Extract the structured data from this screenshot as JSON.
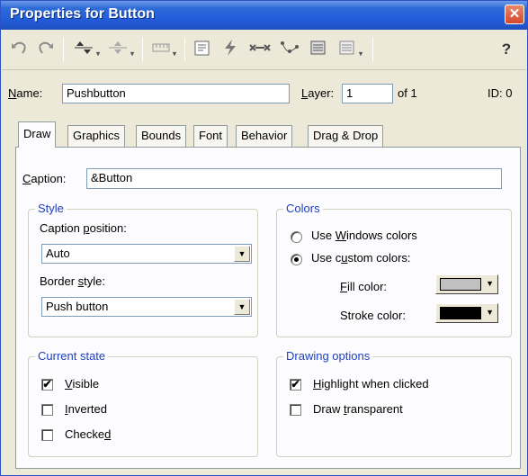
{
  "window": {
    "title": "Properties for Button",
    "close_glyph": "✕"
  },
  "toolbar": {
    "icons": [
      "undo-icon",
      "redo-icon",
      "align-icon",
      "distribute-icon",
      "ruler-icon",
      "properties-icon",
      "lightning-icon",
      "connector-icon",
      "path-icon",
      "list-icon",
      "list-dropdown-icon",
      "help-icon"
    ],
    "help_glyph": "?"
  },
  "object": {
    "name_label_u": "N",
    "name_label_rest": "ame:",
    "name_value": "Pushbutton",
    "layer_label_u": "L",
    "layer_label_rest": "ayer:",
    "layer_value": "1",
    "layer_of": "of 1",
    "id_label": "ID: 0"
  },
  "tabs": [
    "Draw",
    "Graphics",
    "Bounds",
    "Font",
    "Behavior",
    "Drag & Drop"
  ],
  "draw": {
    "caption_label_u": "C",
    "caption_label_rest": "aption:",
    "caption_value": "&Button",
    "style": {
      "title": "Style",
      "caption_position_label_pre": "Caption ",
      "caption_position_label_u": "p",
      "caption_position_label_post": "osition:",
      "caption_position_value": "Auto",
      "border_style_label_pre": "Border ",
      "border_style_label_u": "s",
      "border_style_label_post": "tyle:",
      "border_style_value": "Push button"
    },
    "colors": {
      "title": "Colors",
      "windows_pre": "Use ",
      "windows_u": "W",
      "windows_post": "indows colors",
      "custom_pre": "Use c",
      "custom_u": "u",
      "custom_post": "stom colors:",
      "selected": "custom",
      "fill_label_u": "F",
      "fill_label_rest": "ill color:",
      "fill_color": "#c0c0c0",
      "stroke_label": "Stroke color:",
      "stroke_color": "#000000"
    },
    "current_state": {
      "title": "Current state",
      "visible_u": "V",
      "visible_rest": "isible",
      "visible": true,
      "inverted_u": "I",
      "inverted_rest": "nverted",
      "inverted": false,
      "checked_pre": "Checke",
      "checked_u": "d",
      "checked": false
    },
    "drawing_options": {
      "title": "Drawing options",
      "highlight_u": "H",
      "highlight_rest": "ighlight when clicked",
      "highlight": true,
      "transparent_pre": "Draw ",
      "transparent_u": "t",
      "transparent_post": "ransparent",
      "transparent": false
    }
  },
  "glyphs": {
    "check": "✔",
    "dropdown_arrow": "▼"
  }
}
